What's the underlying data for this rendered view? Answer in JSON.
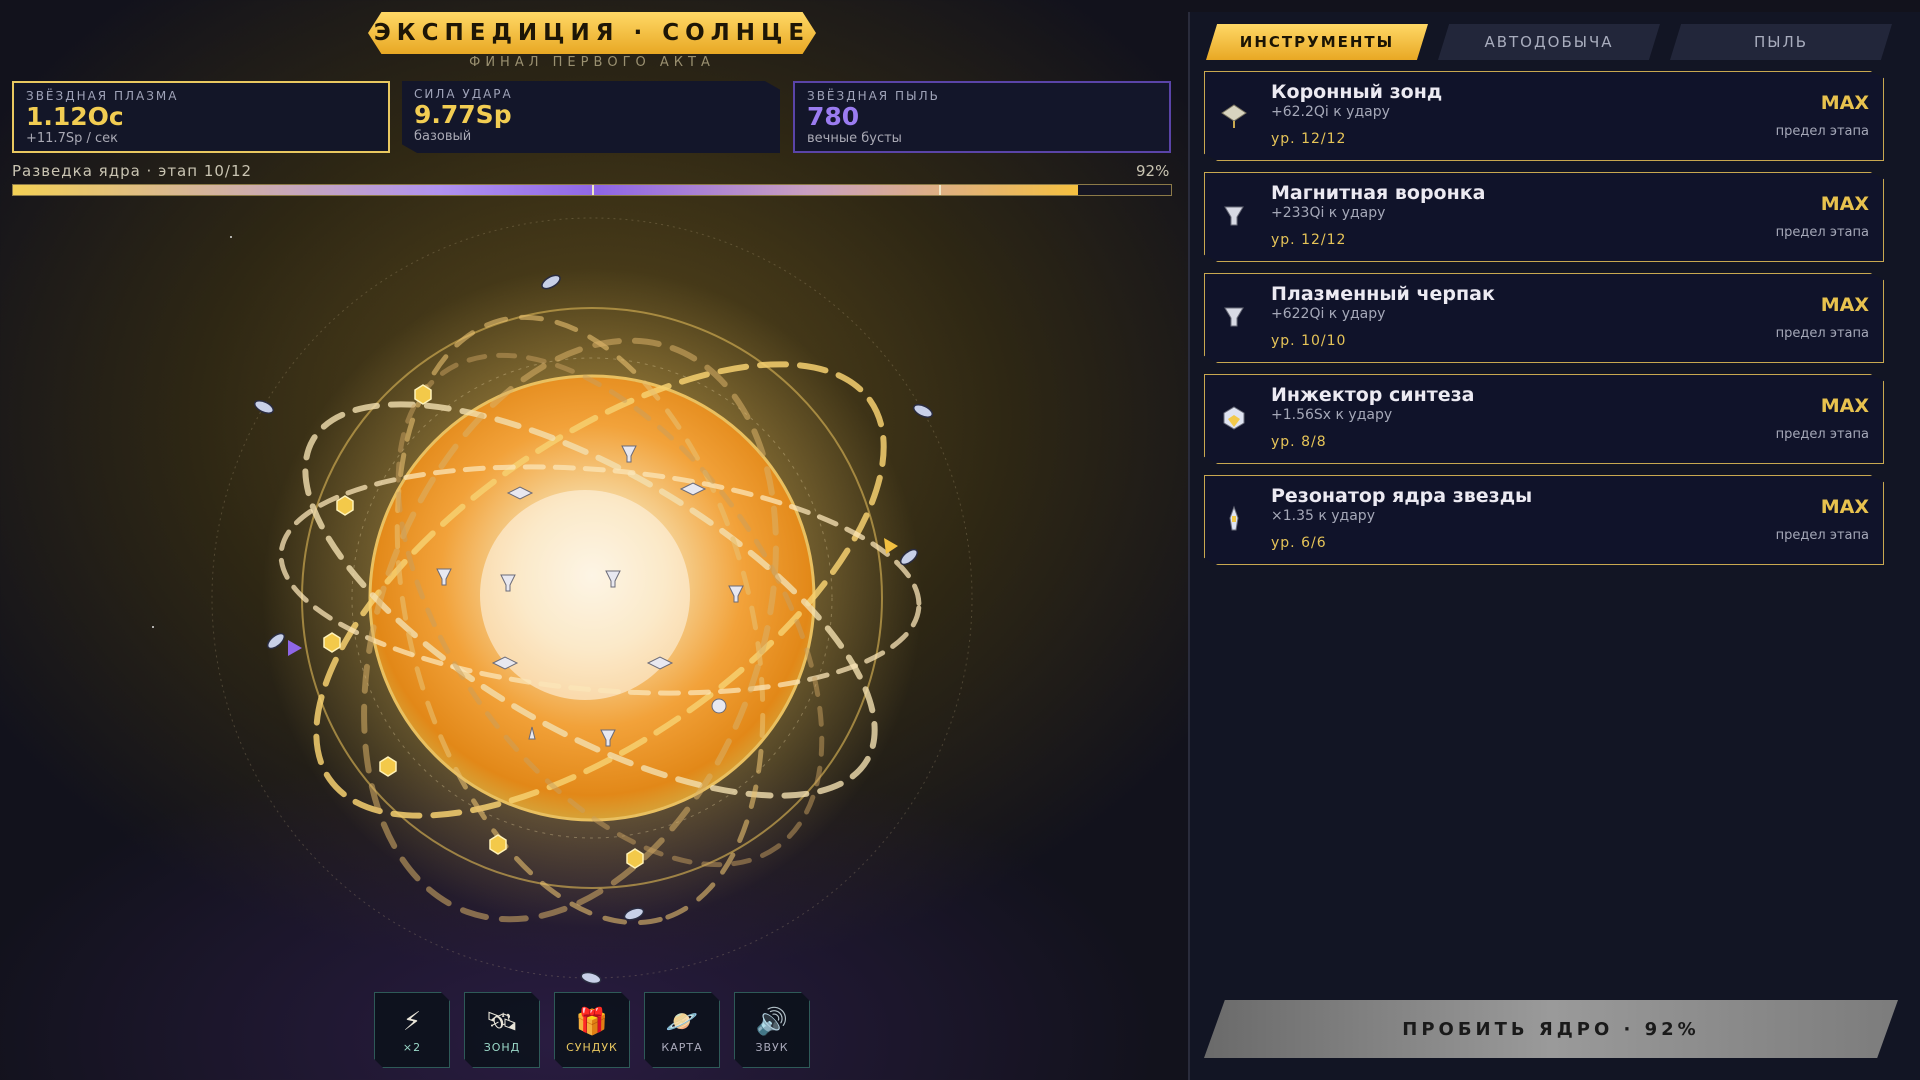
{
  "header": {
    "title": "ЭКСПЕДИЦИЯ · СОЛНЦЕ",
    "subtitle": "ФИНАЛ ПЕРВОГО АКТА"
  },
  "stats": {
    "plasma": {
      "label": "ЗВЁЗДНАЯ ПЛАЗМА",
      "value": "1.12Oc",
      "sub": "+11.7Sp / сек"
    },
    "force": {
      "label": "СИЛА УДАРА",
      "value": "9.77Sp",
      "sub": "базовый"
    },
    "dust": {
      "label": "ЗВЁЗДНАЯ ПЫЛЬ",
      "value": "780",
      "sub": "вечные бусты"
    }
  },
  "progress": {
    "label": "Разведка ядра · этап 10/12",
    "percent_text": "92%",
    "fraction": 0.92,
    "milestones": [
      0.5,
      0.8
    ]
  },
  "toolbar": [
    {
      "icon": "lightning-icon",
      "glyph": "⚡",
      "label": "×2"
    },
    {
      "icon": "satellite-icon",
      "glyph": "🛰",
      "label": "ЗОНД"
    },
    {
      "icon": "gift-icon",
      "glyph": "🎁",
      "label": "СУНДУК"
    },
    {
      "icon": "planet-icon",
      "glyph": "🪐",
      "label": "КАРТА"
    },
    {
      "icon": "speaker-icon",
      "glyph": "🔊",
      "label": "ЗВУК"
    }
  ],
  "panel": {
    "tabs": [
      "ИНСТРУМЕНТЫ",
      "АВТОДОБЫЧА",
      "ПЫЛЬ"
    ],
    "items": [
      {
        "name": "Коронный зонд",
        "bonus": "+62.2Qi к удару",
        "level": "ур. 12/12",
        "max": "MAX",
        "cap": "предел этапа"
      },
      {
        "name": "Магнитная воронка",
        "bonus": "+233Qi к удару",
        "level": "ур. 12/12",
        "max": "MAX",
        "cap": "предел этапа"
      },
      {
        "name": "Плазменный черпак",
        "bonus": "+622Qi к удару",
        "level": "ур. 10/10",
        "max": "MAX",
        "cap": "предел этапа"
      },
      {
        "name": "Инжектор синтеза",
        "bonus": "+1.56Sx к удару",
        "level": "ур. 8/8",
        "max": "MAX",
        "cap": "предел этапа"
      },
      {
        "name": "Резонатор ядра звезды",
        "bonus": "×1.35 к удару",
        "level": "ур. 6/6",
        "max": "MAX",
        "cap": "предел этапа"
      }
    ],
    "break_button": "ПРОБИТЬ ЯДРО · 92%"
  },
  "colors": {
    "gold": "#f2cd52",
    "purple": "#9b7cf0",
    "sun_core": "#f6e6c8",
    "sun_mid": "#f0a020"
  }
}
